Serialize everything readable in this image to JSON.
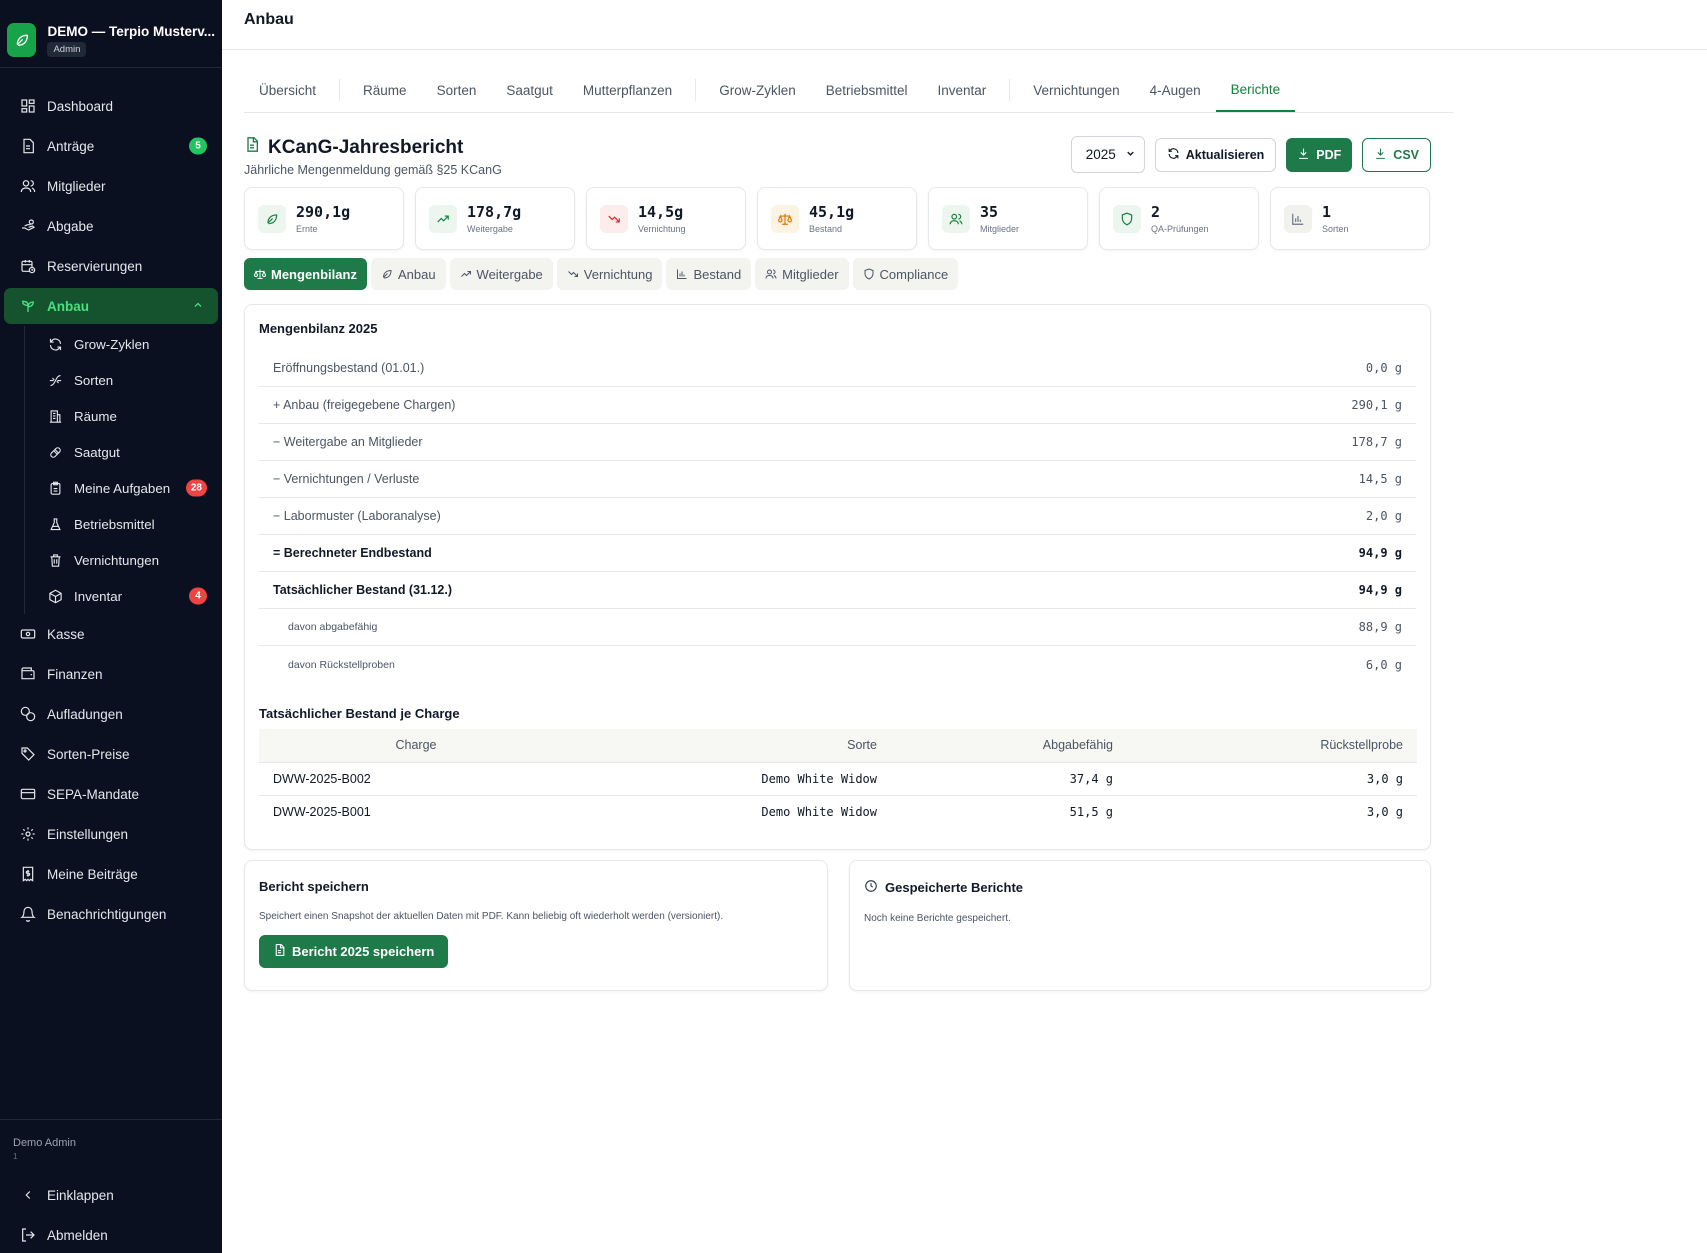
{
  "sidebar": {
    "brand_name": "DEMO — Terpio Musterv...",
    "brand_role": "Admin",
    "items": [
      {
        "label": "Dashboard",
        "icon": "dashboard-icon"
      },
      {
        "label": "Anträge",
        "icon": "document-icon",
        "badge": "5"
      },
      {
        "label": "Mitglieder",
        "icon": "users-icon"
      },
      {
        "label": "Abgabe",
        "icon": "hand-icon"
      },
      {
        "label": "Reservierungen",
        "icon": "calendar-clock-icon"
      },
      {
        "label": "Anbau",
        "icon": "sprout-icon"
      }
    ],
    "sub_items": [
      {
        "label": "Grow-Zyklen",
        "icon": "refresh-icon"
      },
      {
        "label": "Sorten",
        "icon": "dna-icon"
      },
      {
        "label": "Räume",
        "icon": "building-icon"
      },
      {
        "label": "Saatgut",
        "icon": "seed-icon"
      },
      {
        "label": "Meine Aufgaben",
        "icon": "clipboard-icon",
        "badge": "28"
      },
      {
        "label": "Betriebsmittel",
        "icon": "flask-icon"
      },
      {
        "label": "Vernichtungen",
        "icon": "trash-icon"
      },
      {
        "label": "Inventar",
        "icon": "box-icon",
        "badge": "4"
      }
    ],
    "items2": [
      {
        "label": "Kasse",
        "icon": "cash-icon"
      },
      {
        "label": "Finanzen",
        "icon": "wallet-icon"
      },
      {
        "label": "Aufladungen",
        "icon": "coins-icon"
      },
      {
        "label": "Sorten-Preise",
        "icon": "tag-icon"
      },
      {
        "label": "SEPA-Mandate",
        "icon": "card-icon"
      },
      {
        "label": "Einstellungen",
        "icon": "gear-icon"
      },
      {
        "label": "Meine Beiträge",
        "icon": "receipt-icon"
      },
      {
        "label": "Benachrichtigungen",
        "icon": "bell-icon"
      }
    ],
    "user_name": "Demo Admin",
    "user_sub": "1",
    "collapse_label": "Einklappen",
    "logout_label": "Abmelden"
  },
  "header": {
    "title": "Anbau"
  },
  "tabs": [
    "Übersicht",
    "Räume",
    "Sorten",
    "Saatgut",
    "Mutterpflanzen",
    "Grow-Zyklen",
    "Betriebsmittel",
    "Inventar",
    "Vernichtungen",
    "4-Augen",
    "Berichte"
  ],
  "report": {
    "title": "KCanG-Jahresbericht",
    "subtitle": "Jährliche Mengenmeldung gemäß §25 KCanG",
    "year": "2025",
    "refresh_label": "Aktualisieren",
    "pdf_label": "PDF",
    "csv_label": "CSV"
  },
  "kpis": [
    {
      "value": "290,1g",
      "label": "Ernte",
      "icon": "leaf-icon",
      "color": "#15803d",
      "bg": "#ecf5ee"
    },
    {
      "value": "178,7g",
      "label": "Weitergabe",
      "icon": "trending-up-icon",
      "color": "#15803d",
      "bg": "#ecf5ee"
    },
    {
      "value": "14,5g",
      "label": "Vernichtung",
      "icon": "trending-down-icon",
      "color": "#dc2626",
      "bg": "#fdecec"
    },
    {
      "value": "45,1g",
      "label": "Bestand",
      "icon": "scale-icon",
      "color": "#d97706",
      "bg": "#fdf3e3"
    },
    {
      "value": "35",
      "label": "Mitglieder",
      "icon": "users-icon",
      "color": "#15803d",
      "bg": "#ecf5ee"
    },
    {
      "value": "2",
      "label": "QA-Prüfungen",
      "icon": "shield-icon",
      "color": "#15803d",
      "bg": "#ecf5ee"
    },
    {
      "value": "1",
      "label": "Sorten",
      "icon": "bar-chart-icon",
      "color": "#6b7280",
      "bg": "#f1f1ee"
    }
  ],
  "subtabs": [
    {
      "label": "Mengenbilanz",
      "icon": "scale-icon"
    },
    {
      "label": "Anbau",
      "icon": "leaf-icon"
    },
    {
      "label": "Weitergabe",
      "icon": "trending-up-icon"
    },
    {
      "label": "Vernichtung",
      "icon": "trending-down-icon"
    },
    {
      "label": "Bestand",
      "icon": "bar-chart-icon"
    },
    {
      "label": "Mitglieder",
      "icon": "users-icon"
    },
    {
      "label": "Compliance",
      "icon": "shield-icon"
    }
  ],
  "balance": {
    "title": "Mengenbilanz 2025",
    "rows": [
      {
        "label": "Eröffnungsbestand (01.01.)",
        "value": "0,0 g"
      },
      {
        "label": "+ Anbau (freigegebene Chargen)",
        "value": "290,1 g"
      },
      {
        "label": "− Weitergabe an Mitglieder",
        "value": "178,7 g"
      },
      {
        "label": "− Vernichtungen / Verluste",
        "value": "14,5 g"
      },
      {
        "label": "− Labormuster (Laboranalyse)",
        "value": "2,0 g"
      },
      {
        "label": "= Berechneter Endbestand",
        "value": "94,9 g"
      },
      {
        "label": "Tatsächlicher Bestand (31.12.)",
        "value": "94,9 g"
      },
      {
        "label": "davon abgabefähig",
        "value": "88,9 g"
      },
      {
        "label": "davon Rückstellproben",
        "value": "6,0 g"
      }
    ]
  },
  "charges": {
    "title": "Tatsächlicher Bestand je Charge",
    "headers": [
      "Charge",
      "Sorte",
      "Abgabefähig",
      "Rückstellprobe"
    ],
    "rows": [
      [
        "DWW-2025-B002",
        "Demo White Widow",
        "37,4 g",
        "3,0 g"
      ],
      [
        "DWW-2025-B001",
        "Demo White Widow",
        "51,5 g",
        "3,0 g"
      ]
    ]
  },
  "save": {
    "title": "Bericht speichern",
    "desc": "Speichert einen Snapshot der aktuellen Daten mit PDF. Kann beliebig oft wiederholt werden (versioniert).",
    "button": "Bericht 2025 speichern"
  },
  "saved": {
    "title": "Gespeicherte Berichte",
    "empty": "Noch keine Berichte gespeichert."
  }
}
